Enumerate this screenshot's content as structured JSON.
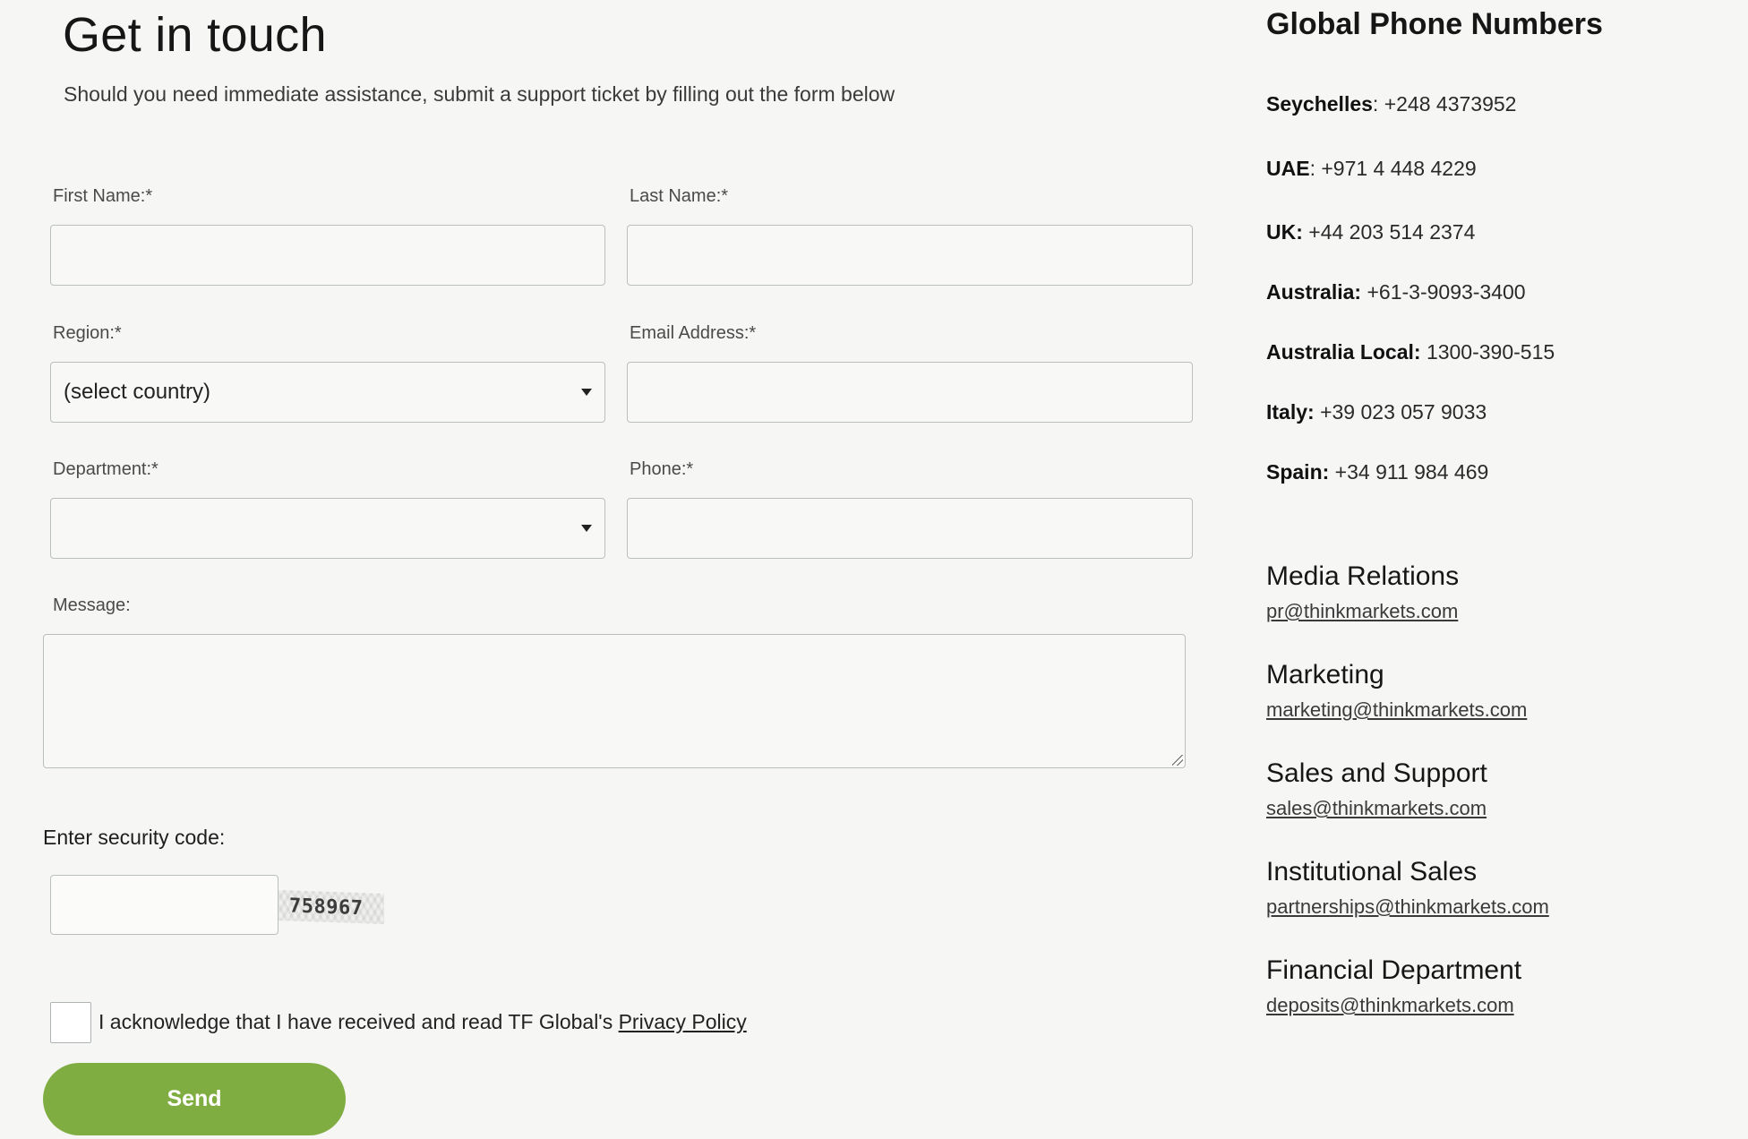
{
  "header": {
    "title": "Get in touch",
    "subtitle": "Should you need immediate assistance, submit a support ticket by filling out the form below"
  },
  "form": {
    "first_name_label": "First Name:*",
    "last_name_label": "Last Name:*",
    "region_label": "Region:*",
    "region_value": "(select country)",
    "email_label": "Email Address:*",
    "department_label": "Department:*",
    "department_value": "",
    "phone_label": "Phone:*",
    "message_label": "Message:",
    "security_label": "Enter security code:",
    "captcha_code": "758967",
    "ack_text": "I acknowledge that I have received and read TF Global's ",
    "privacy_link": "Privacy Policy",
    "send_label": "Send"
  },
  "phones": {
    "title": "Global Phone Numbers",
    "items": [
      {
        "country": "Seychelles",
        "sep": ": ",
        "number": "+248 4373952"
      },
      {
        "country": "UAE",
        "sep": ": ",
        "number": "+971 4 448 4229"
      },
      {
        "country": "UK:",
        "sep": " ",
        "number": "+44 203 514 2374"
      },
      {
        "country": "Australia:",
        "sep": " ",
        "number": "+61-3-9093-3400"
      },
      {
        "country": "Australia Local:",
        "sep": " ",
        "number": "1300-390-515"
      },
      {
        "country": "Italy:",
        "sep": " ",
        "number": "+39 023 057 9033"
      },
      {
        "country": "Spain:",
        "sep": " ",
        "number": "+34 911 984 469"
      }
    ]
  },
  "contacts": [
    {
      "title": "Media Relations",
      "email": "pr@thinkmarkets.com"
    },
    {
      "title": "Marketing",
      "email": "marketing@thinkmarkets.com"
    },
    {
      "title": "Sales and Support",
      "email": "sales@thinkmarkets.com"
    },
    {
      "title": "Institutional Sales",
      "email": "partnerships@thinkmarkets.com"
    },
    {
      "title": "Financial Department",
      "email": "deposits@thinkmarkets.com"
    }
  ],
  "colors": {
    "background": "#f6f6f5",
    "send_button": "#80ad42",
    "input_border": "#b9bfbf"
  },
  "icons": {
    "select_arrow": "chevron-down-icon",
    "textarea_resize": "resize-grip-icon"
  }
}
